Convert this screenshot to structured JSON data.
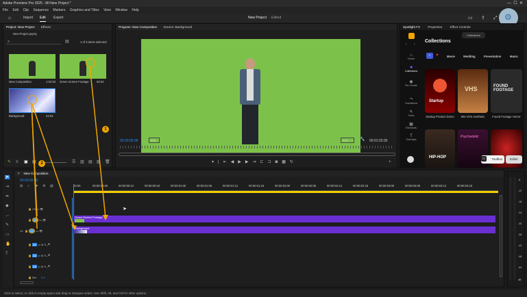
{
  "window": {
    "title": "Adobe Premiere Pro 2025 - MI:New Project *"
  },
  "menu": [
    "File",
    "Edit",
    "Clip",
    "Sequence",
    "Markers",
    "Graphics and Titles",
    "View",
    "Window",
    "Help"
  ],
  "topnav": {
    "tabs": [
      "Import",
      "Edit",
      "Export"
    ],
    "project_title": "New Project",
    "project_state": "- Edited"
  },
  "project_panel": {
    "tabs": [
      "Project: New Project",
      "Effects"
    ],
    "file": "New Project.prproj",
    "selection": "1 of 3 items selected",
    "items": [
      {
        "name": "New Composition",
        "duration": "1:02:00"
      },
      {
        "name": "Green Screen Footage",
        "duration": "56:04"
      },
      {
        "name": "Background",
        "duration": "24:03"
      }
    ]
  },
  "program_monitor": {
    "tabs": [
      "Program: New Composition",
      "Source: Background"
    ],
    "timecode": "00:00:00:00",
    "zoom": "976",
    "fit": "Full",
    "duration": "00:01:02:00"
  },
  "spotlight": {
    "tabs": [
      "Spotlight FX",
      "Properties",
      "Effect Controls"
    ],
    "badge": "Collections",
    "heading": "Collections",
    "categories": [
      "Movie",
      "Wedding",
      "Presentation",
      "Music"
    ],
    "side_items": [
      "Home",
      "Collections",
      "Re-Create",
      "Transitions",
      "Texts",
      "Elements",
      "Overlays"
    ],
    "cards": [
      {
        "title": "Startup Product Demo",
        "art": "Startup"
      },
      {
        "title": "90s VHS Aesthetic",
        "art": "VHS"
      },
      {
        "title": "Found Footage Horror",
        "art": "FOUND FOOTAGE"
      }
    ],
    "row2_art": [
      "HIP-HOP",
      "Psychedelic"
    ],
    "toolbox_label": "Toolbox",
    "editor_label": "Editor"
  },
  "timeline": {
    "tab": "New Composition",
    "timecode": "00:00:00:00",
    "ruler": [
      "00:00",
      "00:00:00:06",
      "00:00:00:12",
      "00:00:00:18",
      "00:00:01:00",
      "00:00:01:06",
      "00:00:01:12",
      "00:00:01:18",
      "00:00:02:00",
      "00:00:02:06",
      "00:00:02:12",
      "00:00:02:18",
      "00:00:03:00",
      "00:00:03:06",
      "00:00:03:12",
      "00:00:03:18"
    ],
    "video_tracks": [
      "V3",
      "V2",
      "V1"
    ],
    "audio_tracks": [
      "A1",
      "A2",
      "A3"
    ],
    "mix": "Mix",
    "mix_val": "0.0",
    "clips": {
      "v2": "Green Screen Footage",
      "v1": "Background"
    },
    "meter_scale": [
      "-6",
      "-12",
      "-18",
      "-24",
      "-30",
      "-36",
      "-42",
      "-48",
      "-54",
      "dB"
    ]
  },
  "callouts": [
    "1",
    "2"
  ],
  "status_text": "Click to select, or click in empty space and drag to marquee select. Use Shift, Alt, and Ctrl for other options.",
  "colors": {
    "accent": "#2d8cf0",
    "clip_purple": "#6a2fd1",
    "green_screen": "#7dc34a",
    "callout": "#f0a500"
  }
}
